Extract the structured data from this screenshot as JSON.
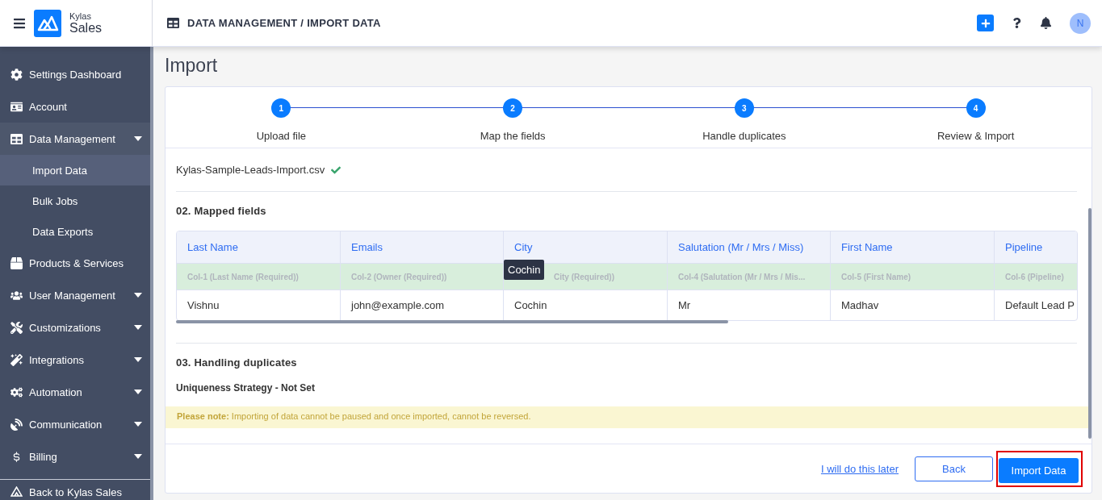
{
  "header": {
    "brand_top": "Kylas",
    "brand_bottom": "Sales",
    "breadcrumb": "DATA MANAGEMENT / IMPORT DATA",
    "avatar": "N"
  },
  "sidebar": {
    "items": [
      {
        "label": "Settings Dashboard",
        "kind": "link",
        "selected": false
      },
      {
        "label": "Account",
        "kind": "link",
        "selected": false
      },
      {
        "label": "Data Management",
        "kind": "group",
        "selected": false,
        "expanded": true,
        "children": [
          {
            "label": "Import Data",
            "selected": true
          },
          {
            "label": "Bulk Jobs",
            "selected": false
          },
          {
            "label": "Data Exports",
            "selected": false
          }
        ]
      },
      {
        "label": "Products & Services",
        "kind": "link",
        "selected": false
      },
      {
        "label": "User Management",
        "kind": "group",
        "selected": false
      },
      {
        "label": "Customizations",
        "kind": "group",
        "selected": false
      },
      {
        "label": "Integrations",
        "kind": "group",
        "selected": false
      },
      {
        "label": "Automation",
        "kind": "group",
        "selected": false
      },
      {
        "label": "Communication",
        "kind": "group",
        "selected": false
      },
      {
        "label": "Billing",
        "kind": "group",
        "selected": false
      }
    ],
    "footer": "Back to Kylas Sales"
  },
  "page": {
    "title": "Import",
    "steps": [
      {
        "number": "1",
        "label": "Upload file"
      },
      {
        "number": "2",
        "label": "Map the fields"
      },
      {
        "number": "3",
        "label": "Handle duplicates"
      },
      {
        "number": "4",
        "label": "Review & Import"
      }
    ],
    "file_name": "Kylas-Sample-Leads-Import.csv",
    "mapped_title": "02. Mapped fields",
    "table": {
      "columns": [
        "Last Name",
        "Emails",
        "City",
        "Salutation (Mr / Mrs / Miss)",
        "First Name",
        "Pipeline"
      ],
      "mapping": [
        "Col-1 (Last Name (Required))",
        "Col-2 (Owner (Required))",
        "City (Required))",
        "Col-4 (Salutation (Mr / Mrs / Mis...",
        "Col-5 (First Name)",
        "Col-6 (Pipeline)"
      ],
      "rows": [
        [
          "Vishnu",
          "john@example.com",
          "Cochin",
          "Mr",
          "Madhav",
          "Default Lead P"
        ]
      ]
    },
    "tooltip": "Cochin",
    "duplicates_title": "03. Handling duplicates",
    "strategy": "Uniqueness Strategy - Not Set",
    "note": "**Please note:** Importing of data cannot be paused and once imported, cannot be reversed.",
    "actions": {
      "later": "I will do this later",
      "back": "Back",
      "import": "Import Data"
    }
  }
}
